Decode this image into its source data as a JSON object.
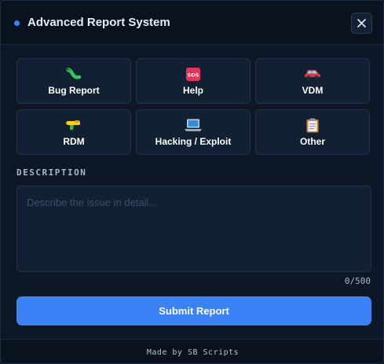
{
  "header": {
    "title": "Advanced Report System",
    "close_icon": "close-icon"
  },
  "categories": [
    {
      "label": "Bug Report",
      "icon": "bug-icon"
    },
    {
      "label": "Help",
      "icon": "sos-icon",
      "icon_text": "SOS"
    },
    {
      "label": "VDM",
      "icon": "car-icon"
    },
    {
      "label": "RDM",
      "icon": "water-pistol-icon"
    },
    {
      "label": "Hacking / Exploit",
      "icon": "laptop-icon"
    },
    {
      "label": "Other",
      "icon": "clipboard-icon"
    }
  ],
  "description": {
    "label": "DESCRIPTION",
    "placeholder": "Describe the issue in detail...",
    "value": "",
    "counter": "0/500"
  },
  "submit_label": "Submit Report",
  "footer": "Made by SB Scripts",
  "colors": {
    "accent": "#3b82f6",
    "background": "#0d1726",
    "card": "#112033"
  }
}
